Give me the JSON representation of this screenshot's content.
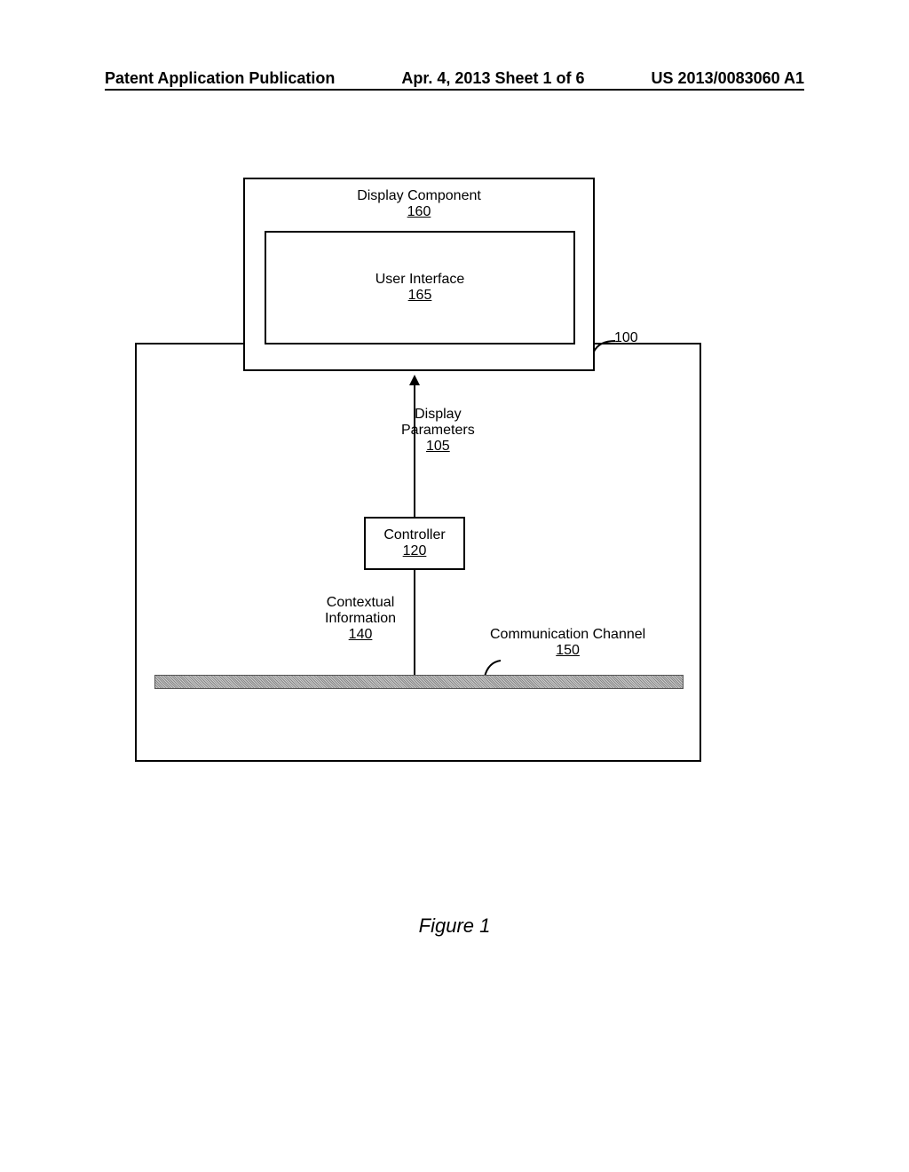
{
  "header": {
    "left": "Patent Application Publication",
    "center": "Apr. 4, 2013  Sheet 1 of 6",
    "right": "US 2013/0083060 A1"
  },
  "figure_caption": "Figure 1",
  "blocks": {
    "display_component": {
      "title": "Display Component",
      "num": "160"
    },
    "user_interface": {
      "title": "User Interface",
      "num": "165"
    },
    "display_parameters": {
      "title": "Display",
      "title2": "Parameters",
      "num": "105"
    },
    "controller": {
      "title": "Controller",
      "num": "120"
    },
    "contextual_information": {
      "title": "Contextual",
      "title2": "Information",
      "num": "140"
    },
    "communication_channel": {
      "title": "Communication Channel",
      "num": "150"
    },
    "system": {
      "num": "100"
    }
  }
}
